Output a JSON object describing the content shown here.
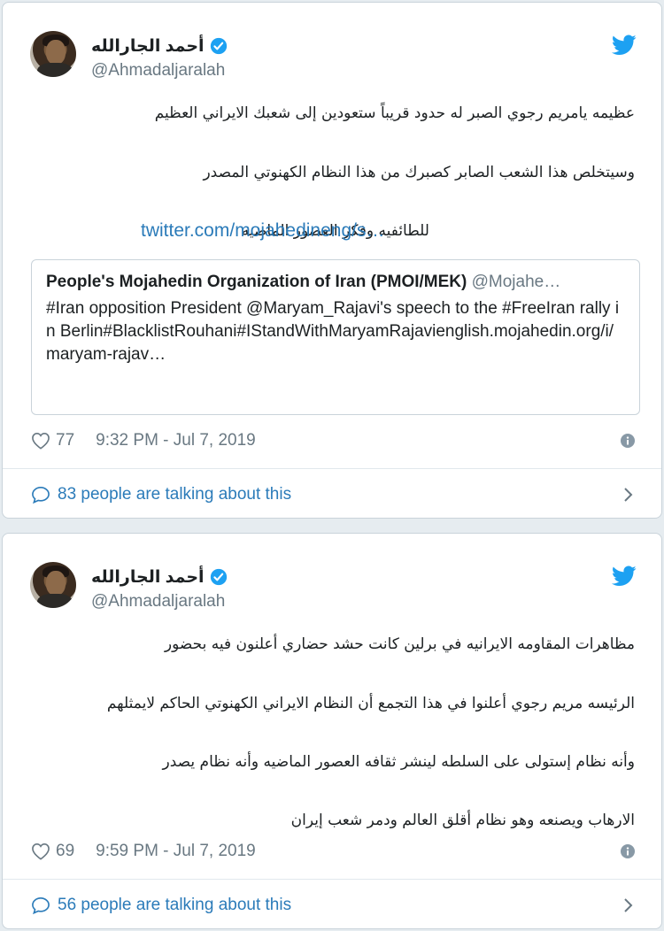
{
  "tweets": [
    {
      "author": {
        "display_name": "أحمد الجارالله",
        "handle": "@Ahmadaljaralah"
      },
      "lines": [
        "عظيمه يامريم رجوي الصبر له حدود قريباً ستعودين إلى شعبك الايراني العظيم",
        "وسيتخلص هذا الشعب  الصابر كصبرك من هذا النظام الكهنوتي  المصدر",
        "للطائفيه وفكر العصور الماضيه"
      ],
      "link_text": "twitter.com/mojahedineng/s…",
      "quote": {
        "author": "People's Mojahedin Organization of Iran (PMOI/MEK)",
        "handle": "@Mojahe…",
        "text": "#Iran opposition President @Maryam_Rajavi's speech to the #FreeIran rally in Berlin#BlacklistRouhani#IStandWithMaryamRajavienglish.mojahedin.org/i/maryam-rajav…"
      },
      "likes": "77",
      "timestamp": "9:32 PM - Jul 7, 2019",
      "talking": "83 people are talking about this"
    },
    {
      "author": {
        "display_name": "أحمد الجارالله",
        "handle": "@Ahmadaljaralah"
      },
      "lines": [
        "مظاهرات المقاومه الايرانيه في برلين  كانت حشد حضاري أعلنون فيه بحضور",
        "الرئيسه مريم رجوي  أعلنوا في هذا التجمع أن النظام الايراني الكهنوتي الحاكم لايمثلهم",
        "وأنه نظام إستولى على السلطه لينشر ثقافه العصور الماضيه وأنه نظام يصدر",
        "الارهاب ويصنعه وهو نظام أقلق العالم ودمر شعب إيران"
      ],
      "likes": "69",
      "timestamp": "9:59 PM - Jul 7, 2019",
      "talking": "56 people are talking about this"
    }
  ],
  "colors": {
    "link": "#2b7bb9",
    "verified": "#1da1f2",
    "twitter_blue": "#1da1f2",
    "meta_gray": "#697882"
  }
}
